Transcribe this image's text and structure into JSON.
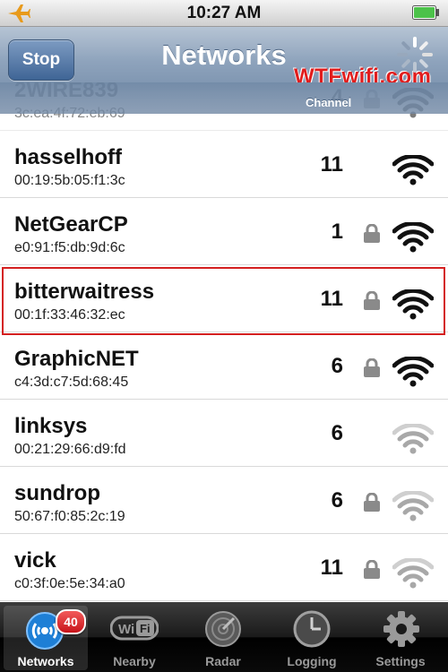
{
  "status_bar": {
    "time": "10:27 AM",
    "airplane_icon": "airplane-icon",
    "battery_icon": "battery-icon"
  },
  "nav_bar": {
    "stop_label": "Stop",
    "title": "Networks",
    "watermark": "WTFwifi.com",
    "channel_label": "Channel"
  },
  "networks": [
    {
      "name": "2WIRE839",
      "mac": "3c:ea:4f:72:eb:69",
      "channel": "4",
      "locked": true,
      "signal": "strong"
    },
    {
      "name": "hasselhoff",
      "mac": "00:19:5b:05:f1:3c",
      "channel": "11",
      "locked": false,
      "signal": "strong"
    },
    {
      "name": "NetGearCP",
      "mac": "e0:91:f5:db:9d:6c",
      "channel": "1",
      "locked": true,
      "signal": "strong"
    },
    {
      "name": "bitterwaitress",
      "mac": "00:1f:33:46:32:ec",
      "channel": "11",
      "locked": true,
      "signal": "strong"
    },
    {
      "name": "GraphicNET",
      "mac": "c4:3d:c7:5d:68:45",
      "channel": "6",
      "locked": true,
      "signal": "strong"
    },
    {
      "name": "linksys",
      "mac": "00:21:29:66:d9:fd",
      "channel": "6",
      "locked": false,
      "signal": "weak"
    },
    {
      "name": "sundrop",
      "mac": "50:67:f0:85:2c:19",
      "channel": "6",
      "locked": true,
      "signal": "weak"
    },
    {
      "name": "vick",
      "mac": "c0:3f:0e:5e:34:a0",
      "channel": "11",
      "locked": true,
      "signal": "weak"
    }
  ],
  "tab_bar": {
    "tabs": [
      {
        "label": "Networks",
        "badge": "40"
      },
      {
        "label": "Nearby"
      },
      {
        "label": "Radar"
      },
      {
        "label": "Logging"
      },
      {
        "label": "Settings"
      }
    ]
  },
  "colors": {
    "highlight": "#d42020",
    "watermark": "#e11d1d",
    "nav_bar": "#6d86a4"
  }
}
